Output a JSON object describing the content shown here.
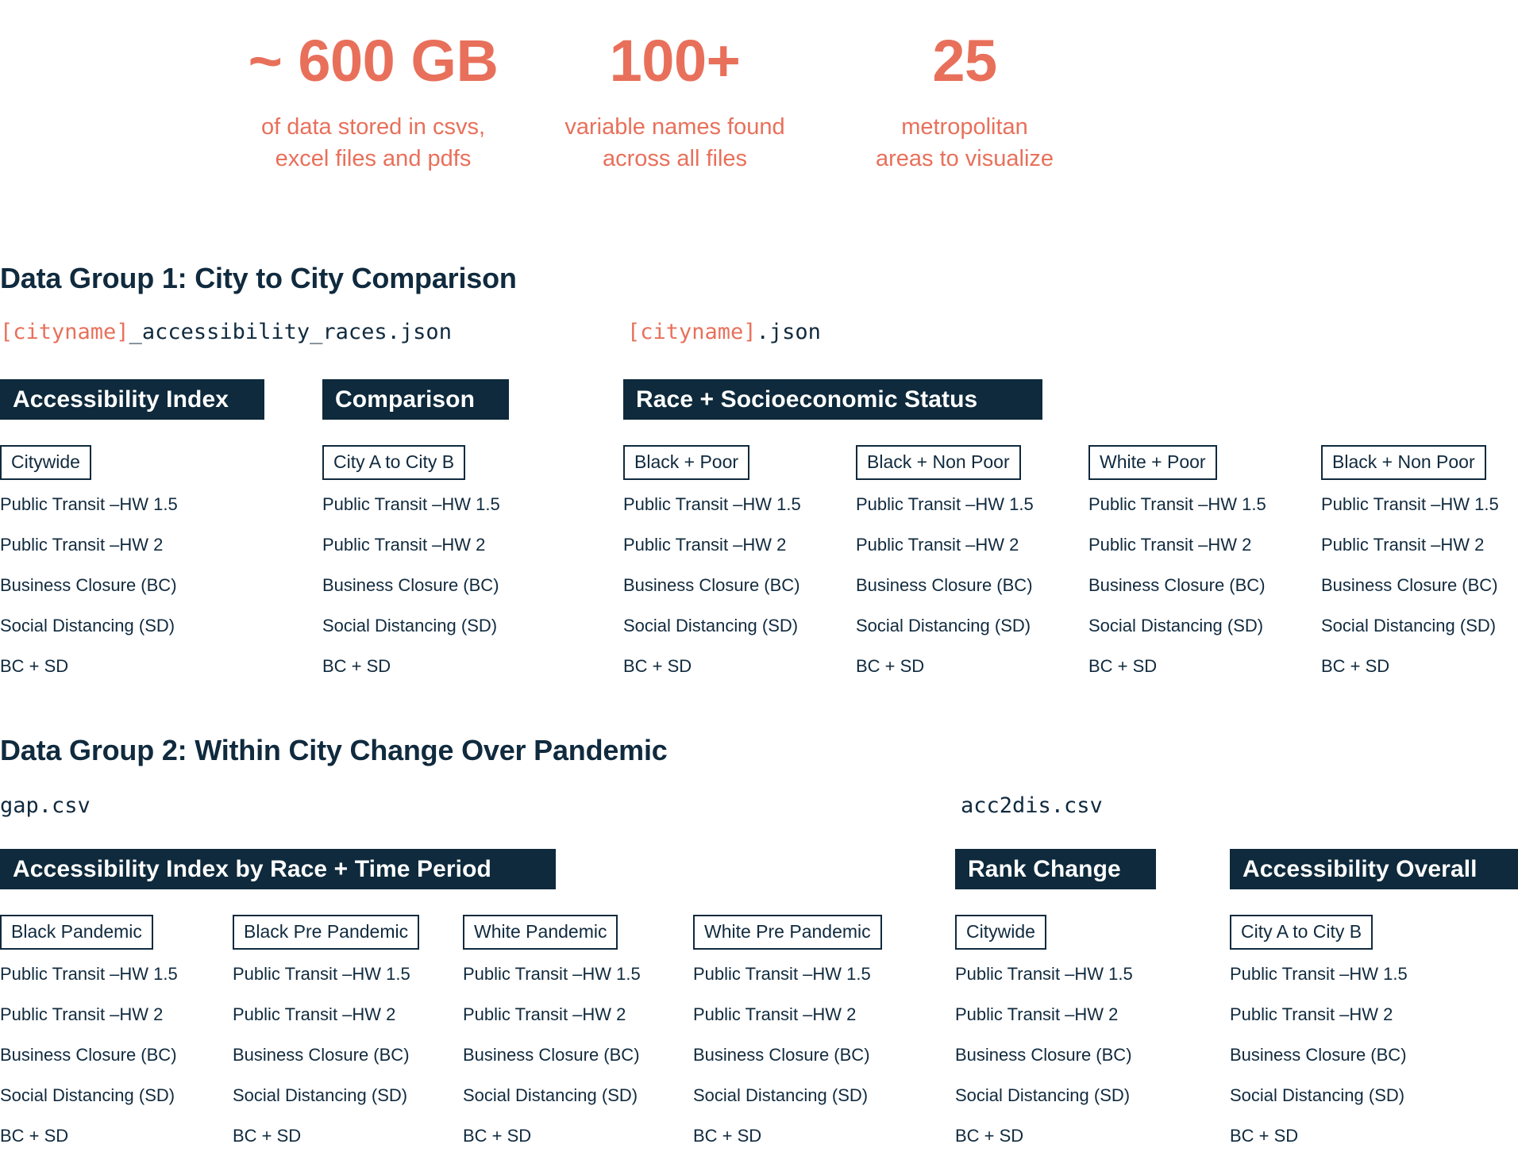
{
  "stats": [
    {
      "value": "~ 600 GB",
      "caption": "of data stored in csvs,\nexcel files and pdfs"
    },
    {
      "value": "100+",
      "caption": "variable names found\nacross all files"
    },
    {
      "value": "25",
      "caption": "metropolitan\nareas to visualize"
    }
  ],
  "groups": [
    {
      "title": "Data Group 1: City to City Comparison",
      "files": [
        {
          "placeholder": "[cityname]",
          "rest": "_accessibility_races.json"
        },
        {
          "placeholder": "[cityname]",
          "rest": ".json"
        }
      ],
      "sections": [
        {
          "label": "Accessibility Index"
        },
        {
          "label": "Comparison"
        },
        {
          "label": "Race + Socioeconomic Status"
        }
      ],
      "columns": [
        {
          "chip": "Citywide",
          "items": [
            "Public Transit –HW 1.5",
            "Public Transit –HW 2",
            "Business Closure (BC)",
            "Social Distancing (SD)",
            "BC + SD"
          ]
        },
        {
          "chip": "City A to City B",
          "items": [
            "Public Transit –HW 1.5",
            "Public Transit –HW 2",
            "Business Closure (BC)",
            "Social Distancing (SD)",
            "BC + SD"
          ]
        },
        {
          "chip": "Black + Poor",
          "items": [
            "Public Transit –HW 1.5",
            "Public Transit –HW 2",
            "Business Closure (BC)",
            "Social Distancing (SD)",
            "BC + SD"
          ]
        },
        {
          "chip": "Black + Non Poor",
          "items": [
            "Public Transit –HW 1.5",
            "Public Transit –HW 2",
            "Business Closure (BC)",
            "Social Distancing (SD)",
            "BC + SD"
          ]
        },
        {
          "chip": "White + Poor",
          "items": [
            "Public Transit –HW 1.5",
            "Public Transit –HW 2",
            "Business Closure (BC)",
            "Social Distancing (SD)",
            "BC + SD"
          ]
        },
        {
          "chip": "Black + Non Poor",
          "items": [
            "Public Transit –HW 1.5",
            "Public Transit –HW 2",
            "Business Closure (BC)",
            "Social Distancing (SD)",
            "BC + SD"
          ]
        }
      ]
    },
    {
      "title": "Data Group 2: Within City Change Over Pandemic",
      "files": [
        {
          "placeholder": "",
          "rest": "gap.csv"
        },
        {
          "placeholder": "",
          "rest": "acc2dis.csv"
        }
      ],
      "sections": [
        {
          "label": "Accessibility Index by Race + Time Period"
        },
        {
          "label": "Rank Change"
        },
        {
          "label": "Accessibility Overall"
        }
      ],
      "columns": [
        {
          "chip": "Black Pandemic",
          "items": [
            "Public Transit –HW 1.5",
            "Public Transit –HW 2",
            "Business Closure (BC)",
            "Social Distancing (SD)",
            "BC + SD"
          ]
        },
        {
          "chip": "Black Pre Pandemic",
          "items": [
            "Public Transit –HW 1.5",
            "Public Transit –HW 2",
            "Business Closure (BC)",
            "Social Distancing (SD)",
            "BC + SD"
          ]
        },
        {
          "chip": "White Pandemic",
          "items": [
            "Public Transit –HW 1.5",
            "Public Transit –HW 2",
            "Business Closure (BC)",
            "Social Distancing (SD)",
            "BC + SD"
          ]
        },
        {
          "chip": "White Pre Pandemic",
          "items": [
            "Public Transit –HW 1.5",
            "Public Transit –HW 2",
            "Business Closure (BC)",
            "Social Distancing (SD)",
            "BC + SD"
          ]
        },
        {
          "chip": "Citywide",
          "items": [
            "Public Transit –HW 1.5",
            "Public Transit –HW 2",
            "Business Closure (BC)",
            "Social Distancing (SD)",
            "BC + SD"
          ]
        },
        {
          "chip": "City A to City B",
          "items": [
            "Public Transit –HW 1.5",
            "Public Transit –HW 2",
            "Business Closure (BC)",
            "Social Distancing (SD)",
            "BC + SD"
          ]
        }
      ]
    }
  ],
  "colors": {
    "accent": "#E8705B",
    "dark": "#0E2A3C",
    "text": "#102A3E",
    "background": "#FFFFFF"
  }
}
